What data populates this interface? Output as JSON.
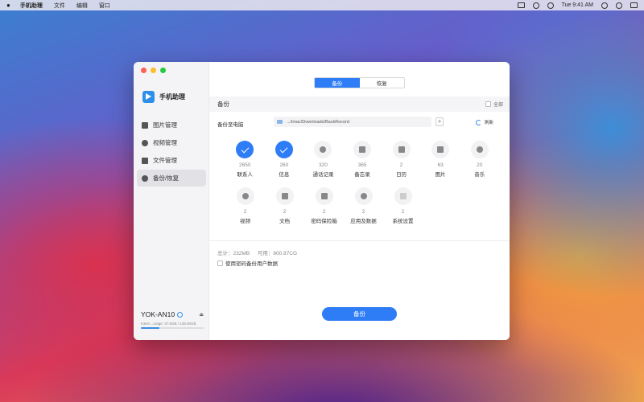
{
  "menubar": {
    "items": [
      "手机助理",
      "文件",
      "编辑",
      "窗口"
    ],
    "clock": "Tue 9:41 AM"
  },
  "app": {
    "name": "手机助理"
  },
  "sidebar": {
    "items": [
      {
        "label": "图片管理",
        "icon": "photo-icon"
      },
      {
        "label": "视频管理",
        "icon": "video-icon"
      },
      {
        "label": "文件管理",
        "icon": "folder-icon"
      },
      {
        "label": "备份/恢复",
        "icon": "backup-icon",
        "active": true
      }
    ]
  },
  "device": {
    "name": "YOK-AN10",
    "storage": "Intern...orage: 37.0GB / 128.00GB",
    "storage_used_fraction": 0.29
  },
  "tabs": [
    {
      "label": "备份",
      "active": true
    },
    {
      "label": "恢复",
      "active": false
    }
  ],
  "section": {
    "title": "备份",
    "select_all": "全部"
  },
  "path": {
    "label": "备份至电脑",
    "value": ".../imac/Downloads/BackRecord",
    "go": ">",
    "refresh": "刷新"
  },
  "categories_row1": [
    {
      "count": "2650",
      "label": "联系人",
      "checked": true
    },
    {
      "count": "260",
      "label": "信息",
      "checked": true
    },
    {
      "count": "320",
      "label": "通话记录",
      "checked": false
    },
    {
      "count": "365",
      "label": "备忘录",
      "checked": false
    },
    {
      "count": "2",
      "label": "日历",
      "checked": false
    },
    {
      "count": "63",
      "label": "图片",
      "checked": false
    },
    {
      "count": "20",
      "label": "音乐",
      "checked": false
    }
  ],
  "categories_row2": [
    {
      "count": "2",
      "label": "视频"
    },
    {
      "count": "2",
      "label": "文档"
    },
    {
      "count": "2",
      "label": "密码保险箱"
    },
    {
      "count": "2",
      "label": "应用及数据"
    },
    {
      "count": "2",
      "label": "系统设置"
    }
  ],
  "stats": {
    "total": "总计：232MB",
    "available": "可用：800.87CG"
  },
  "encrypt": {
    "label": "使用密码备份用户数据"
  },
  "action": {
    "label": "备份"
  }
}
